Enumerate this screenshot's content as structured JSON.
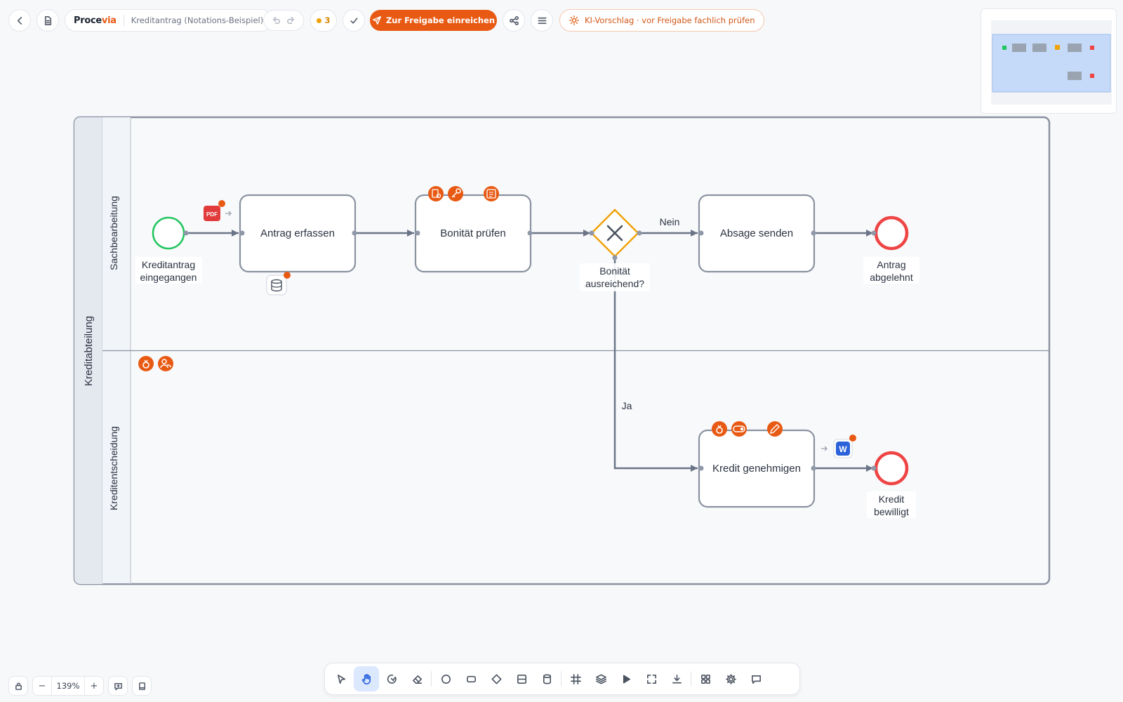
{
  "header": {
    "brand_main": "Proce",
    "brand_accent": "via",
    "doc_title": "Kreditantrag (Notations-Beispiel)",
    "issue_count": "3",
    "submit_label": "Zur Freigabe einreichen",
    "ai_notice": "KI-Vorschlag · vor Freigabe fachlich prüfen"
  },
  "colors": {
    "accent": "#e85a13",
    "start_event": "#22c55e",
    "end_event": "#ef4444",
    "gateway": "#f0a20a",
    "active_tool": "#dbe8fd",
    "flow": "#6b7588"
  },
  "diagram": {
    "pool": "Kreditabteilung",
    "lanes": [
      "Sachbearbeitung",
      "Kreditentscheidung"
    ],
    "start_event": [
      "Kreditantrag",
      "eingegangen"
    ],
    "tasks": {
      "capture": "Antrag erfassen",
      "check": "Bonität prüfen",
      "reject": "Absage senden",
      "approve": "Kredit genehmigen"
    },
    "gateway": [
      "Bonität",
      "ausreichend?"
    ],
    "flow_no": "Nein",
    "flow_yes": "Ja",
    "end_rejected": [
      "Antrag",
      "abgelehnt"
    ],
    "end_approved": [
      "Kredit",
      "bewilligt"
    ],
    "pdf_badge": "PDF",
    "word_badge": "W"
  },
  "zoom": {
    "value": "139%",
    "minus": "−",
    "plus": "+"
  },
  "toolbar": [
    "select-tool",
    "hand-tool",
    "lasso-tool",
    "eraser-tool",
    "event-tool",
    "task-tool",
    "gateway-tool",
    "lane-tool",
    "data-store-tool",
    "grid-toggle",
    "layers",
    "simulate",
    "fullscreen",
    "download",
    "apps",
    "settings",
    "comments"
  ]
}
